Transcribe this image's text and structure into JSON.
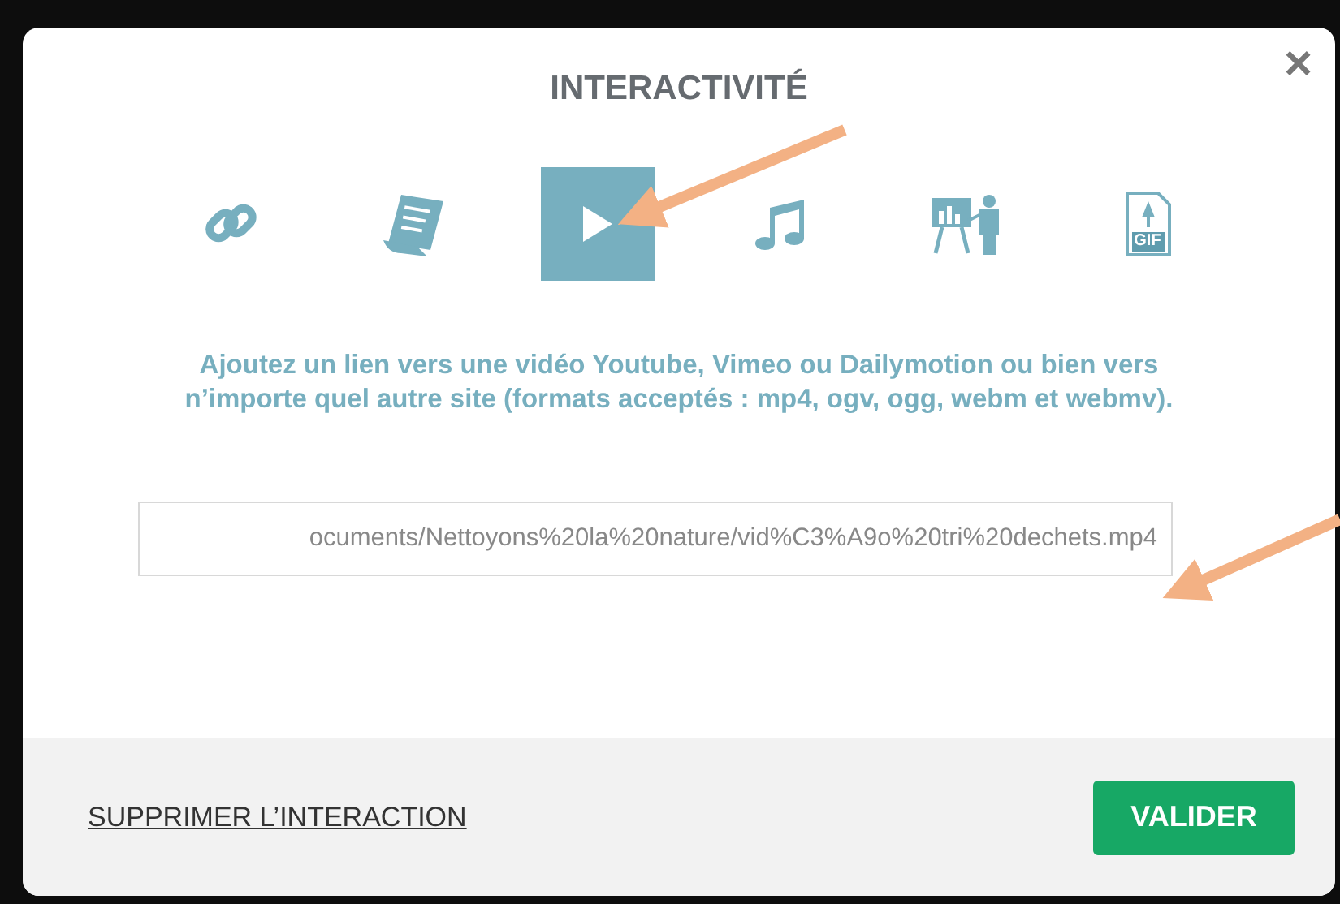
{
  "dialog": {
    "title": "INTERACTIVITÉ",
    "close": "×"
  },
  "tools": [
    {
      "kind": "link",
      "selected": false
    },
    {
      "kind": "document",
      "selected": false
    },
    {
      "kind": "video",
      "selected": true
    },
    {
      "kind": "music",
      "selected": false
    },
    {
      "kind": "presentation",
      "selected": false
    },
    {
      "kind": "gif",
      "selected": false,
      "label": "GIF"
    }
  ],
  "description": "Ajoutez un lien vers une vidéo Youtube, Vimeo ou Dailymotion ou bien vers n’importe quel autre site (formats acceptés : mp4, ogv, ogg, webm et webmv).",
  "url_field": {
    "value": "ocuments/Nettoyons%20la%20nature/vid%C3%A9o%20tri%20dechets.mp4"
  },
  "footer": {
    "delete_link": "SUPPRIMER L’INTERACTION",
    "submit": "VALIDER"
  }
}
